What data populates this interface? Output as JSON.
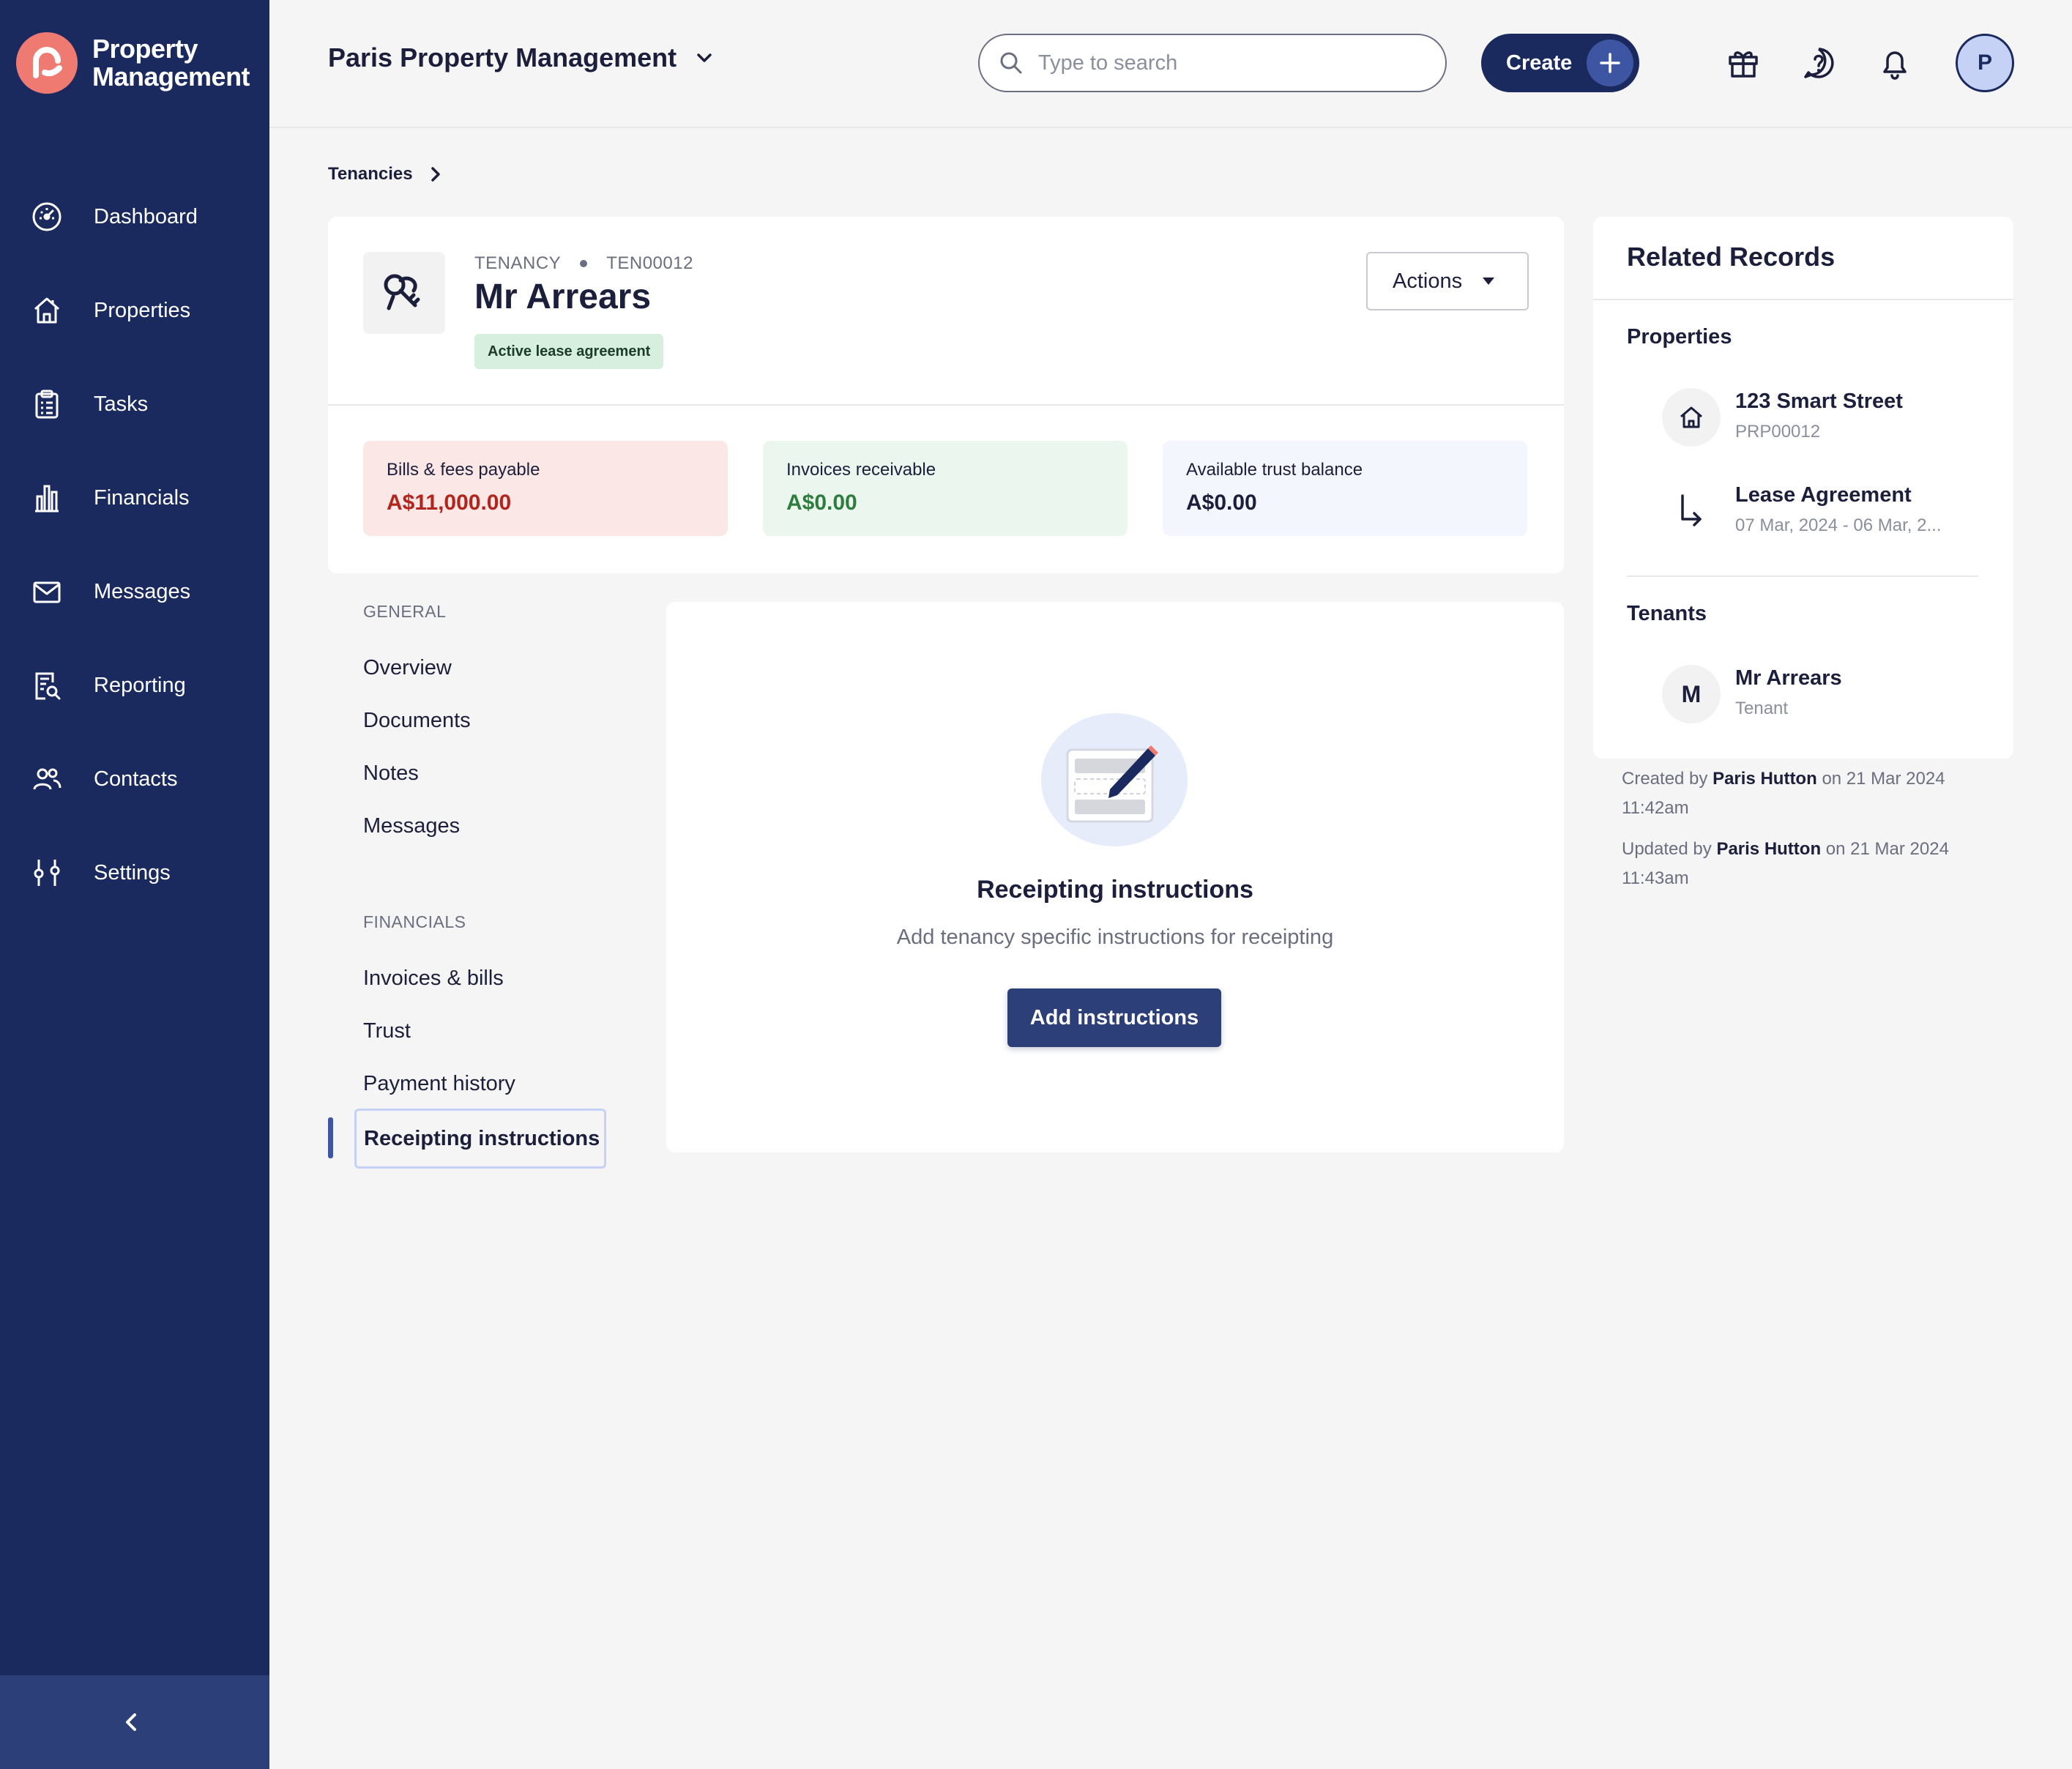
{
  "app": {
    "logo_line1": "Property",
    "logo_line2": "Management",
    "org_name": "Paris Property Management"
  },
  "sidebar": {
    "items": [
      {
        "label": "Dashboard",
        "icon": "dashboard-icon"
      },
      {
        "label": "Properties",
        "icon": "home-icon"
      },
      {
        "label": "Tasks",
        "icon": "clipboard-icon"
      },
      {
        "label": "Financials",
        "icon": "bar-chart-icon"
      },
      {
        "label": "Messages",
        "icon": "envelope-icon"
      },
      {
        "label": "Reporting",
        "icon": "report-search-icon"
      },
      {
        "label": "Contacts",
        "icon": "people-icon"
      },
      {
        "label": "Settings",
        "icon": "sliders-icon"
      }
    ]
  },
  "header": {
    "search_placeholder": "Type to search",
    "create_label": "Create",
    "avatar_initial": "P"
  },
  "breadcrumb": {
    "items": [
      "Tenancies"
    ]
  },
  "tenancy": {
    "type_label": "TENANCY",
    "code": "TEN00012",
    "title": "Mr Arrears",
    "status_badge": "Active lease agreement",
    "actions_label": "Actions"
  },
  "stats": [
    {
      "label": "Bills & fees payable",
      "value": "A$11,000.00"
    },
    {
      "label": "Invoices receivable",
      "value": "A$0.00"
    },
    {
      "label": "Available trust balance",
      "value": "A$0.00"
    }
  ],
  "subnav": {
    "general_heading": "GENERAL",
    "general_items": [
      "Overview",
      "Documents",
      "Notes",
      "Messages"
    ],
    "financials_heading": "FINANCIALS",
    "financials_items": [
      "Invoices & bills",
      "Trust",
      "Payment history"
    ],
    "active_item": "Receipting instructions"
  },
  "panel": {
    "title": "Receipting instructions",
    "description": "Add tenancy specific instructions for receipting",
    "button_label": "Add instructions"
  },
  "related": {
    "title": "Related Records",
    "properties_heading": "Properties",
    "property": {
      "name": "123 Smart Street",
      "code": "PRP00012"
    },
    "lease": {
      "name": "Lease Agreement",
      "dates": "07 Mar, 2024 - 06 Mar, 2..."
    },
    "tenants_heading": "Tenants",
    "tenant": {
      "initial": "M",
      "name": "Mr Arrears",
      "role": "Tenant"
    }
  },
  "audit": {
    "created_prefix": "Created by",
    "created_by": "Paris Hutton",
    "created_on": "on 21 Mar 2024",
    "created_time": "11:42am",
    "updated_prefix": "Updated by",
    "updated_by": "Paris Hutton",
    "updated_on": "on 21 Mar 2024",
    "updated_time": "11:43am"
  },
  "colors": {
    "sidebar_bg": "#1b2a5e",
    "primary_button": "#2c3f79",
    "accent_logo": "#ef7a72",
    "payable_red": "#b3241c",
    "receivable_green": "#2e7d3e"
  }
}
